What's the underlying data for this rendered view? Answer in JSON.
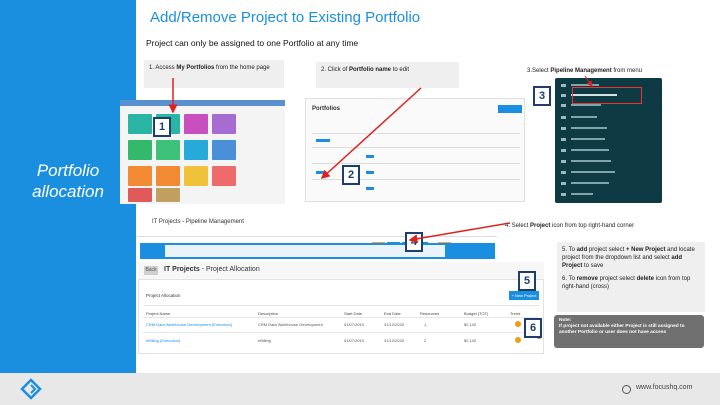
{
  "slide": {
    "title": "Add/Remove Project to Existing Portfolio",
    "subtitle": "Project can only be assigned to one Portfolio at any time"
  },
  "left_panel": {
    "title_line1": "Portfolio",
    "title_line2": "allocation"
  },
  "steps": {
    "s1_prefix": "1. Access ",
    "s1_bold": "My Portfolios",
    "s1_suffix": " from the home page",
    "s2_prefix": "2. Click of ",
    "s2_bold": "Portfolio name",
    "s2_suffix": " to edit",
    "s3_prefix": "3.Select ",
    "s3_bold": "Pipeline Management",
    "s3_suffix": " from menu",
    "s4_prefix": "4. Select ",
    "s4_bold": "Project",
    "s4_suffix": " icon from top right-hand corner",
    "s5_prefix": "5. To ",
    "s5_bold1": "add",
    "s5_mid": " project select ",
    "s5_bold2": "+ New Project",
    "s5_rest": " and locate project from the dropdown list and select ",
    "s5_bold3": "add Project",
    "s5_end": " to save",
    "s6_prefix": "6. To ",
    "s6_bold1": "remove",
    "s6_mid": " project select ",
    "s6_bold2": "delete",
    "s6_end": " icon from top right-hand (cross)"
  },
  "badges": [
    "1",
    "2",
    "3",
    "4",
    "5",
    "6"
  ],
  "thumb2": {
    "title": "Portfolios"
  },
  "thumb3": {
    "menu": [
      "Overview",
      "Pipeline Management",
      "Dashboard",
      "Reporting",
      "Action Tracking",
      "Risk Management",
      "Issue Management",
      "Budget Management",
      "Resource Management",
      "Benefits Tracking",
      "Settings"
    ]
  },
  "bar4": {
    "title": "IT Projects - Pipeline Management"
  },
  "it_panel": {
    "back": "Back",
    "title_bold": "IT Projects",
    "title_rest": " - Project Allocation",
    "alloc_label": "Project Allocation",
    "new_project": "+ New Project",
    "headers": [
      "Project Name",
      "Description",
      "Start Date",
      "End Date",
      "Resources",
      "Budget (TOT)",
      "Trend"
    ],
    "rows": [
      [
        "CRM Data Warehouse Development (Execution)",
        "CRM Data Warehouse Development",
        "01/07/2019",
        "31/12/2020",
        "1",
        "$2,100",
        ""
      ],
      [
        "eBilling (Execution)",
        "eBilling",
        "01/07/2019",
        "31/12/2020",
        "2",
        "$2,100",
        ""
      ]
    ]
  },
  "note": {
    "label": "Note:",
    "text": "If project not available either Project is still assigned to another Portfolio or user does not have access"
  },
  "footer": {
    "url": "www.focushq.com"
  },
  "colors": {
    "brand_blue": "#1a8fe0",
    "accent_red": "#e02020",
    "menu_dark": "#0e3b43"
  }
}
